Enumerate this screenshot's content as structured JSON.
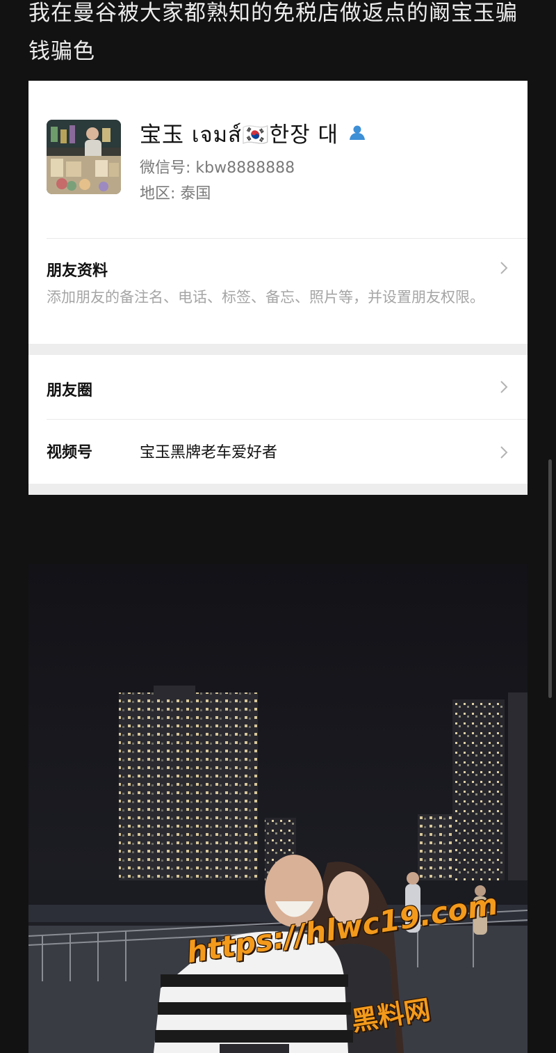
{
  "post": {
    "title": "我在曼谷被大家都熟知的免税店做返点的阚宝玉骗钱骗色"
  },
  "profile": {
    "name": "宝玉 เจมส์🇰🇷한장 대",
    "wechat_id": "微信号: kbw8888888",
    "region": "地区: 泰国"
  },
  "friend_info": {
    "title": "朋友资料",
    "description": "添加朋友的备注名、电话、标签、备忘、照片等，并设置朋友权限。"
  },
  "moments": {
    "title": "朋友圈"
  },
  "channels": {
    "title": "视频号",
    "value": "宝玉黑牌老车爱好者"
  },
  "watermark": {
    "url": "https://hlwc19.com",
    "site": "黑料网"
  },
  "colors": {
    "background": "#121212",
    "card": "#ffffff",
    "accent_icon": "#3d8fd6",
    "watermark": "#f39a1c"
  }
}
